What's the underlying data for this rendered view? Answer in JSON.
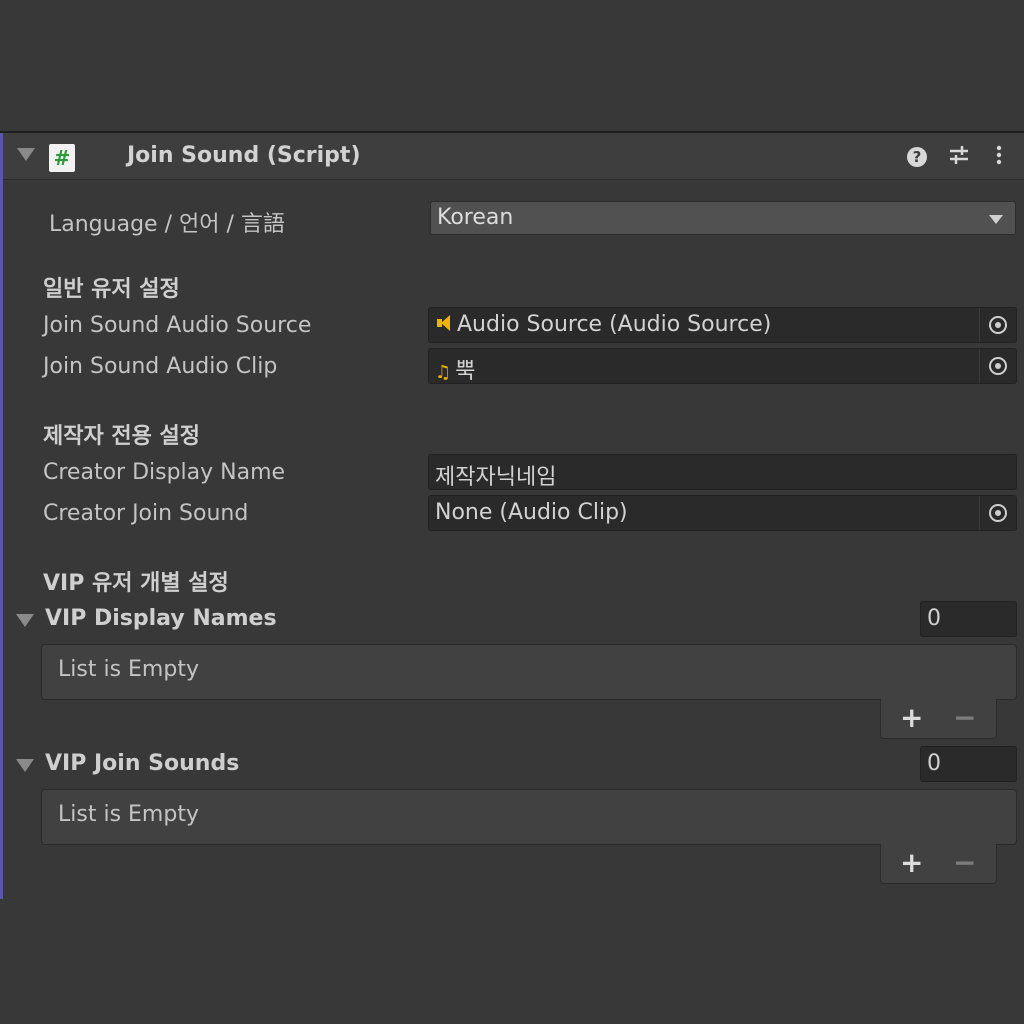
{
  "component": {
    "title": "Join Sound (Script)",
    "script_icon": "#",
    "icons": [
      "help-icon",
      "presets-icon",
      "more-options-icon"
    ]
  },
  "language": {
    "label": "Language / 언어 / 言語",
    "value": "Korean"
  },
  "general_section": {
    "heading": "일반 유저 설정",
    "audio_source": {
      "label": "Join Sound Audio Source",
      "value": "Audio Source (Audio Source)",
      "icon": "audio-source-icon"
    },
    "audio_clip": {
      "label": "Join Sound Audio Clip",
      "value": "뿍",
      "icon": "audio-clip-icon"
    }
  },
  "creator_section": {
    "heading": "제작자 전용 설정",
    "display_name": {
      "label": "Creator Display Name",
      "value": "제작자닉네임"
    },
    "join_sound": {
      "label": "Creator Join Sound",
      "value": "None (Audio Clip)"
    }
  },
  "vip_section": {
    "heading": "VIP 유저 개별 설정",
    "display_names": {
      "label": "VIP Display Names",
      "count": "0",
      "empty_text": "List is Empty",
      "add": "+",
      "remove": "−"
    },
    "join_sounds": {
      "label": "VIP Join Sounds",
      "count": "0",
      "empty_text": "List is Empty",
      "add": "+",
      "remove": "−"
    }
  },
  "colors": {
    "background": "#383838",
    "header": "#3e3e3e",
    "field": "#2a2a2a",
    "accent": "#5a56a8",
    "asset_icon": "#f0b400"
  }
}
